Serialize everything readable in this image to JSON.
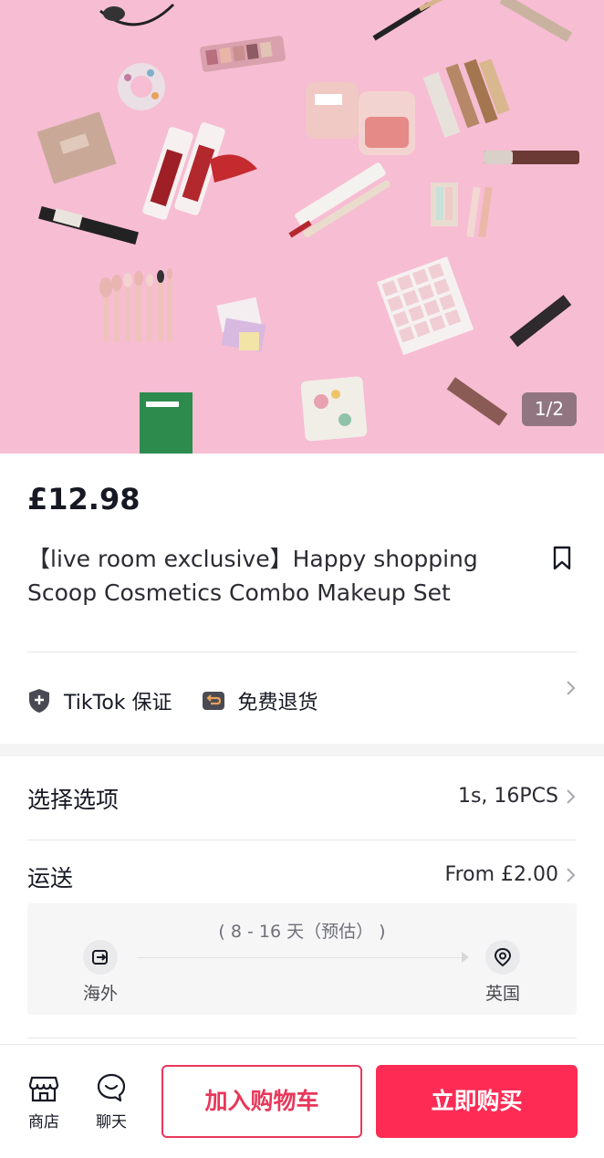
{
  "gallery": {
    "counter": "1/2",
    "cosmetics_colors": {
      "background": "#f7bdd3",
      "blush_pink": "#f2b8b8",
      "lipstick_red": "#b3282d",
      "brush_pink": "#e9b5b1",
      "mask_green": "#2e8b4e"
    }
  },
  "product": {
    "price": "£12.98",
    "title_line1": "【live room exclusive】Happy shopping",
    "title_line2": "Scoop Cosmetics Combo Makeup Set"
  },
  "guarantees": {
    "tiktok": "TikTok 保证",
    "returns": "免费退货"
  },
  "options": {
    "label": "选择选项",
    "value": "1s, 16PCS"
  },
  "shipping": {
    "label": "运送",
    "value": "From £2.00",
    "estimate": "( 8 - 16 天（预估） )",
    "from": "海外",
    "to": "英国"
  },
  "bottom_bar": {
    "shop": "商店",
    "chat": "聊天",
    "add_to_cart": "加入购物车",
    "buy_now": "立即购买"
  },
  "colors": {
    "accent": "#fe2c55",
    "accent_outline": "#e8375a"
  }
}
